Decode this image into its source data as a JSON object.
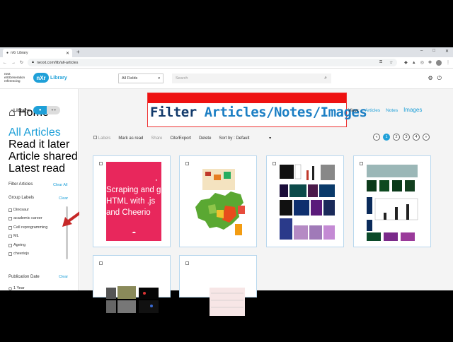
{
  "browser": {
    "tab_title": "nXr Library",
    "url": "nexxt.com/lib/all-articles",
    "window_controls": [
      "–",
      "□",
      "✕"
    ]
  },
  "header": {
    "brand_lines": [
      "next",
      "eXtGeneration",
      "referencing"
    ],
    "logo_mark": "nXr",
    "logo_text": "Library",
    "field_select": "All Fields",
    "search_placeholder": "Search"
  },
  "sidebar": {
    "home": "Home",
    "nav": [
      "All Articles",
      "Read it later",
      "Article shared to you",
      "Latest read"
    ],
    "filter_title": "Filter Articles",
    "clear_all": "Clear All",
    "group_labels_title": "Group Labels",
    "clear": "Clear",
    "labels": [
      "Dinosaur",
      "academic career",
      "Cell reprogramming",
      "ML",
      "Ageing",
      "cheeriojs"
    ],
    "pub_date_title": "Publication Date",
    "pub_date_clear": "Clear",
    "pub_options": [
      "1 Year"
    ]
  },
  "main": {
    "library_label": "Library:",
    "view_label": "View:",
    "views": [
      "Articles",
      "Notes",
      "Images"
    ],
    "active_view": "Images",
    "banner": {
      "part1": "Filter ",
      "part2": "Articles/Notes/Images"
    },
    "toolbar": {
      "labels": "Labels",
      "mark_read": "Mark as read",
      "share": "Share",
      "cite": "Cite/Export",
      "delete": "Delete",
      "sort_label": "Sort by :",
      "sort_value": "Default"
    },
    "pages": [
      "1",
      "2",
      "3",
      "4"
    ],
    "current_page": "1",
    "card1_text": "Scraping and g HTML with .js and Cheerio"
  },
  "colors": {
    "accent": "#1fa0d8",
    "banner_red": "#e11111",
    "card1_bg": "#e8275c",
    "china_green": "#5aa832"
  }
}
